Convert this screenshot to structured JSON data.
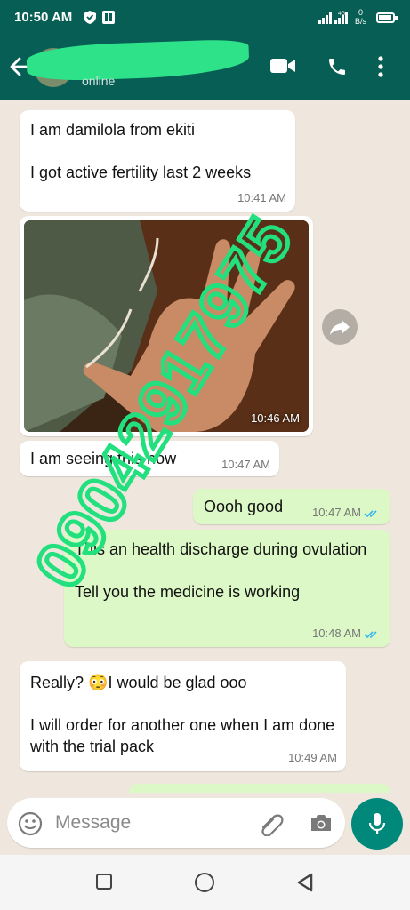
{
  "status_bar": {
    "time": "10:50 AM",
    "network": "4G",
    "speed_value": "0",
    "speed_unit": "B/s"
  },
  "header": {
    "contact_name": "",
    "contact_status": "online"
  },
  "messages": [
    {
      "direction": "in",
      "lines": "I am damilola from ekiti\n\nI got active fertility last 2 weeks",
      "time": "10:41 AM"
    },
    {
      "direction": "in",
      "type": "image",
      "time": "10:46 AM"
    },
    {
      "direction": "in",
      "lines": "I am seeing this now",
      "time": "10:47 AM"
    },
    {
      "direction": "out",
      "lines": "Oooh good",
      "time": "10:47 AM",
      "read": true
    },
    {
      "direction": "out",
      "lines": "This an health discharge during ovulation\n\nTell you the medicine is working",
      "time": "10:48 AM",
      "read": true
    },
    {
      "direction": "in",
      "lines": "Really? 😳I would be glad ooo\n\nI will order for another one when I am done with the trial pack",
      "time": "10:49 AM"
    }
  ],
  "watermark": {
    "text": "09042917975",
    "color": "#22e07e"
  },
  "input": {
    "placeholder": "Message"
  },
  "colors": {
    "header": "#075e54",
    "outgoing": "#dcf8c6",
    "incoming": "#ffffff",
    "accent": "#00897b",
    "read_ticks": "#34b7f1"
  }
}
